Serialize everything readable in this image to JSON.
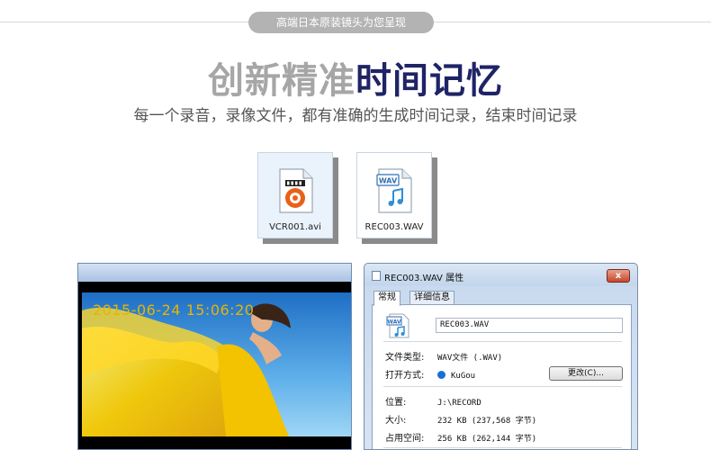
{
  "banner": {
    "label": "高端日本原装镜头为您呈现"
  },
  "headline": {
    "part1": "创新精准",
    "part2": "时间记忆"
  },
  "subline": "每一个录音，录像文件，都有准确的生成时间记录，结束时间记录",
  "files": [
    {
      "name": "VCR001.avi",
      "icon": "video-file-icon"
    },
    {
      "name": "REC003.WAV",
      "icon": "wav-file-icon",
      "badge": "WAV"
    }
  ],
  "video": {
    "timestamp": "2015-06-24  15:06:20"
  },
  "dialog": {
    "title": "REC003.WAV 属性",
    "close_label": "x",
    "tabs": [
      {
        "label": "常规"
      },
      {
        "label": "详细信息"
      }
    ],
    "icon_badge": "WAV",
    "filename": "REC003.WAV",
    "file_type_label": "文件类型:",
    "file_type_value": "WAV文件 (.WAV)",
    "open_with_label": "打开方式:",
    "open_with_value": "KuGou",
    "change_button": "更改(C)...",
    "location_label": "位置:",
    "location_value": "J:\\RECORD",
    "size_label": "大小:",
    "size_value": "232 KB (237,568 字节)",
    "disk_size_label": "占用空间:",
    "disk_size_value": "256 KB (262,144 字节)"
  },
  "colors": {
    "navy": "#1f2466",
    "gray_heading": "#a6a6a6",
    "timestamp": "#e8b400"
  }
}
